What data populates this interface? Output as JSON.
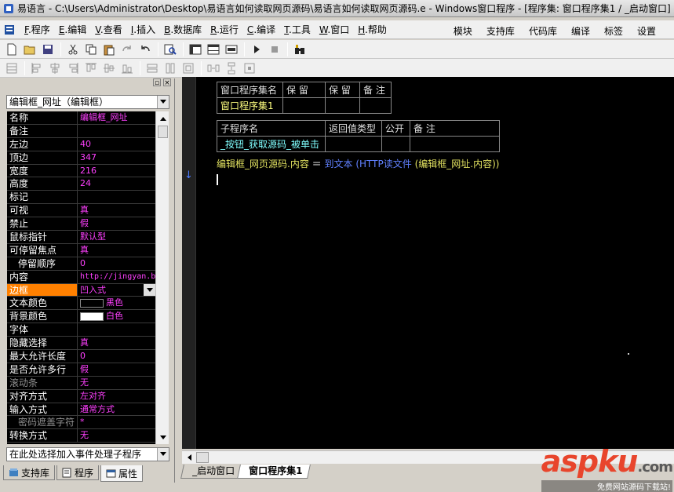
{
  "title_bar": {
    "text": "易语言 - C:\\Users\\Administrator\\Desktop\\易语言如何读取网页源码\\易语言如何读取网页源码.e - Windows窗口程序 - [程序集: 窗口程序集1 / _启动窗口]"
  },
  "menu": {
    "items": [
      {
        "key": "F",
        "label": ".程序"
      },
      {
        "key": "E",
        "label": ".编辑"
      },
      {
        "key": "V",
        "label": ".查看"
      },
      {
        "key": "I",
        "label": ".插入"
      },
      {
        "key": "B",
        "label": ".数据库"
      },
      {
        "key": "R",
        "label": ".运行"
      },
      {
        "key": "C",
        "label": ".编译"
      },
      {
        "key": "T",
        "label": ".工具"
      },
      {
        "key": "W",
        "label": ".窗口"
      },
      {
        "key": "H",
        "label": ".帮助"
      }
    ],
    "right_items": [
      "模块",
      "支持库",
      "代码库",
      "编译",
      "标签",
      "设置"
    ]
  },
  "left_panel": {
    "selected_component": "编辑框_网址（编辑框）",
    "properties": [
      {
        "name": "名称",
        "value": "编辑框_网址"
      },
      {
        "name": "备注",
        "value": ""
      },
      {
        "name": "左边",
        "value": "40"
      },
      {
        "name": "顶边",
        "value": "347"
      },
      {
        "name": "宽度",
        "value": "216"
      },
      {
        "name": "高度",
        "value": "24"
      },
      {
        "name": "标记",
        "value": ""
      },
      {
        "name": "可视",
        "value": "真"
      },
      {
        "name": "禁止",
        "value": "假"
      },
      {
        "name": "鼠标指针",
        "value": "默认型"
      },
      {
        "name": "可停留焦点",
        "value": "真"
      },
      {
        "name": "停留顺序",
        "value": "0"
      },
      {
        "name": "内容",
        "value": "http://jingyan.b"
      },
      {
        "name": "边框",
        "value": "凹入式"
      },
      {
        "name": "文本颜色",
        "value": "黑色"
      },
      {
        "name": "背景颜色",
        "value": "白色"
      },
      {
        "name": "字体",
        "value": ""
      },
      {
        "name": "隐藏选择",
        "value": "真"
      },
      {
        "name": "最大允许长度",
        "value": "0"
      },
      {
        "name": "是否允许多行",
        "value": "假"
      },
      {
        "name": "滚动条",
        "value": "无"
      },
      {
        "name": "对齐方式",
        "value": "左对齐"
      },
      {
        "name": "输入方式",
        "value": "通常方式"
      },
      {
        "name": "密码遮盖字符",
        "value": "*"
      },
      {
        "name": "转换方式",
        "value": "无"
      }
    ],
    "event_combo": "在此处选择加入事件处理子程序",
    "tabs": [
      "支持库",
      "程序",
      "属性"
    ]
  },
  "editor": {
    "assembly_table": {
      "headers": [
        "窗口程序集名",
        "保 留",
        "保 留",
        "备 注"
      ],
      "row": [
        "窗口程序集1",
        "",
        "",
        ""
      ]
    },
    "sub_table": {
      "headers": [
        "子程序名",
        "返回值类型",
        "公开",
        "备 注"
      ],
      "row": [
        "_按钮_获取源码_被单击",
        "",
        "",
        ""
      ]
    },
    "code": {
      "target": "编辑框_网页源码.内容",
      "op": "＝",
      "func": "到文本",
      "inner": "(HTTP读文件",
      "arg": "(编辑框_网址.内容))"
    },
    "tabs": [
      "_启动窗口",
      "窗口程序集1"
    ]
  },
  "watermark": {
    "asp": "asp",
    "ku": "ku",
    "com": ".com",
    "sub": "免费网站源码下载站!"
  }
}
